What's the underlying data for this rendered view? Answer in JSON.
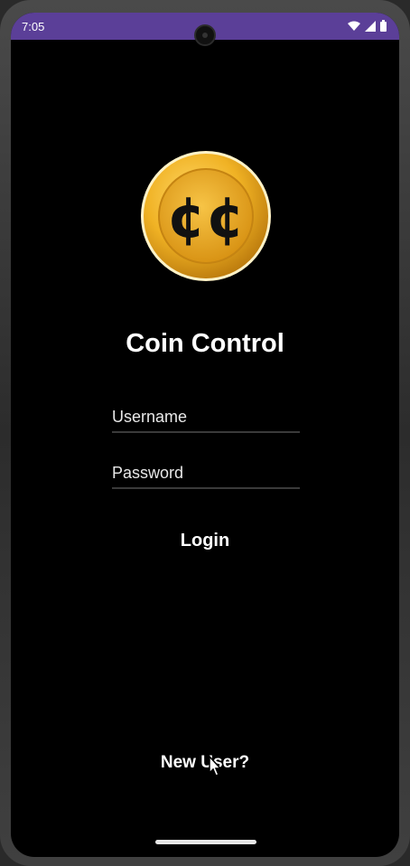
{
  "status_bar": {
    "time": "7:05",
    "background": "#5b3f98",
    "icons": [
      "wifi-icon",
      "cellular-signal-icon",
      "battery-icon"
    ]
  },
  "logo": {
    "symbol": "¢¢",
    "icon": "coin-logo-icon",
    "colors": {
      "gold": "#f0b224",
      "gold_dark": "#b9780c"
    }
  },
  "app": {
    "title": "Coin Control"
  },
  "form": {
    "username_placeholder": "Username",
    "password_placeholder": "Password",
    "login_label": "Login",
    "new_user_label": "New User?"
  }
}
